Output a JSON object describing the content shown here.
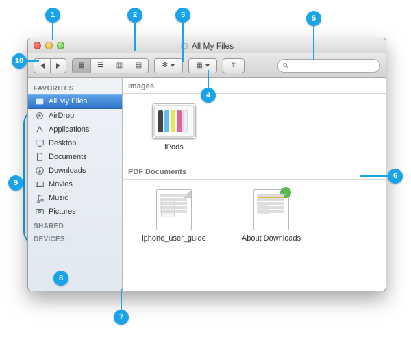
{
  "window": {
    "title": "All My Files"
  },
  "search": {
    "placeholder": ""
  },
  "sidebar": {
    "sections": [
      {
        "heading": "FAVORITES",
        "items": [
          {
            "label": "All My Files",
            "icon": "all-my-files-icon",
            "selected": true
          },
          {
            "label": "AirDrop",
            "icon": "airdrop-icon"
          },
          {
            "label": "Applications",
            "icon": "applications-icon"
          },
          {
            "label": "Desktop",
            "icon": "desktop-icon"
          },
          {
            "label": "Documents",
            "icon": "documents-icon"
          },
          {
            "label": "Downloads",
            "icon": "downloads-icon"
          },
          {
            "label": "Movies",
            "icon": "movies-icon"
          },
          {
            "label": "Music",
            "icon": "music-icon"
          },
          {
            "label": "Pictures",
            "icon": "pictures-icon"
          }
        ]
      },
      {
        "heading": "SHARED",
        "items": []
      },
      {
        "heading": "DEVICES",
        "items": []
      }
    ]
  },
  "content": {
    "sections": [
      {
        "heading": "Images",
        "items": [
          {
            "label": "iPods",
            "kind": "image"
          }
        ]
      },
      {
        "heading": "PDF Documents",
        "items": [
          {
            "label": "iphone_user_guide",
            "kind": "pdf"
          },
          {
            "label": "About Downloads",
            "kind": "pdf-download"
          }
        ]
      }
    ]
  },
  "callouts": [
    "1",
    "2",
    "3",
    "4",
    "5",
    "6",
    "7",
    "8",
    "9",
    "10"
  ]
}
